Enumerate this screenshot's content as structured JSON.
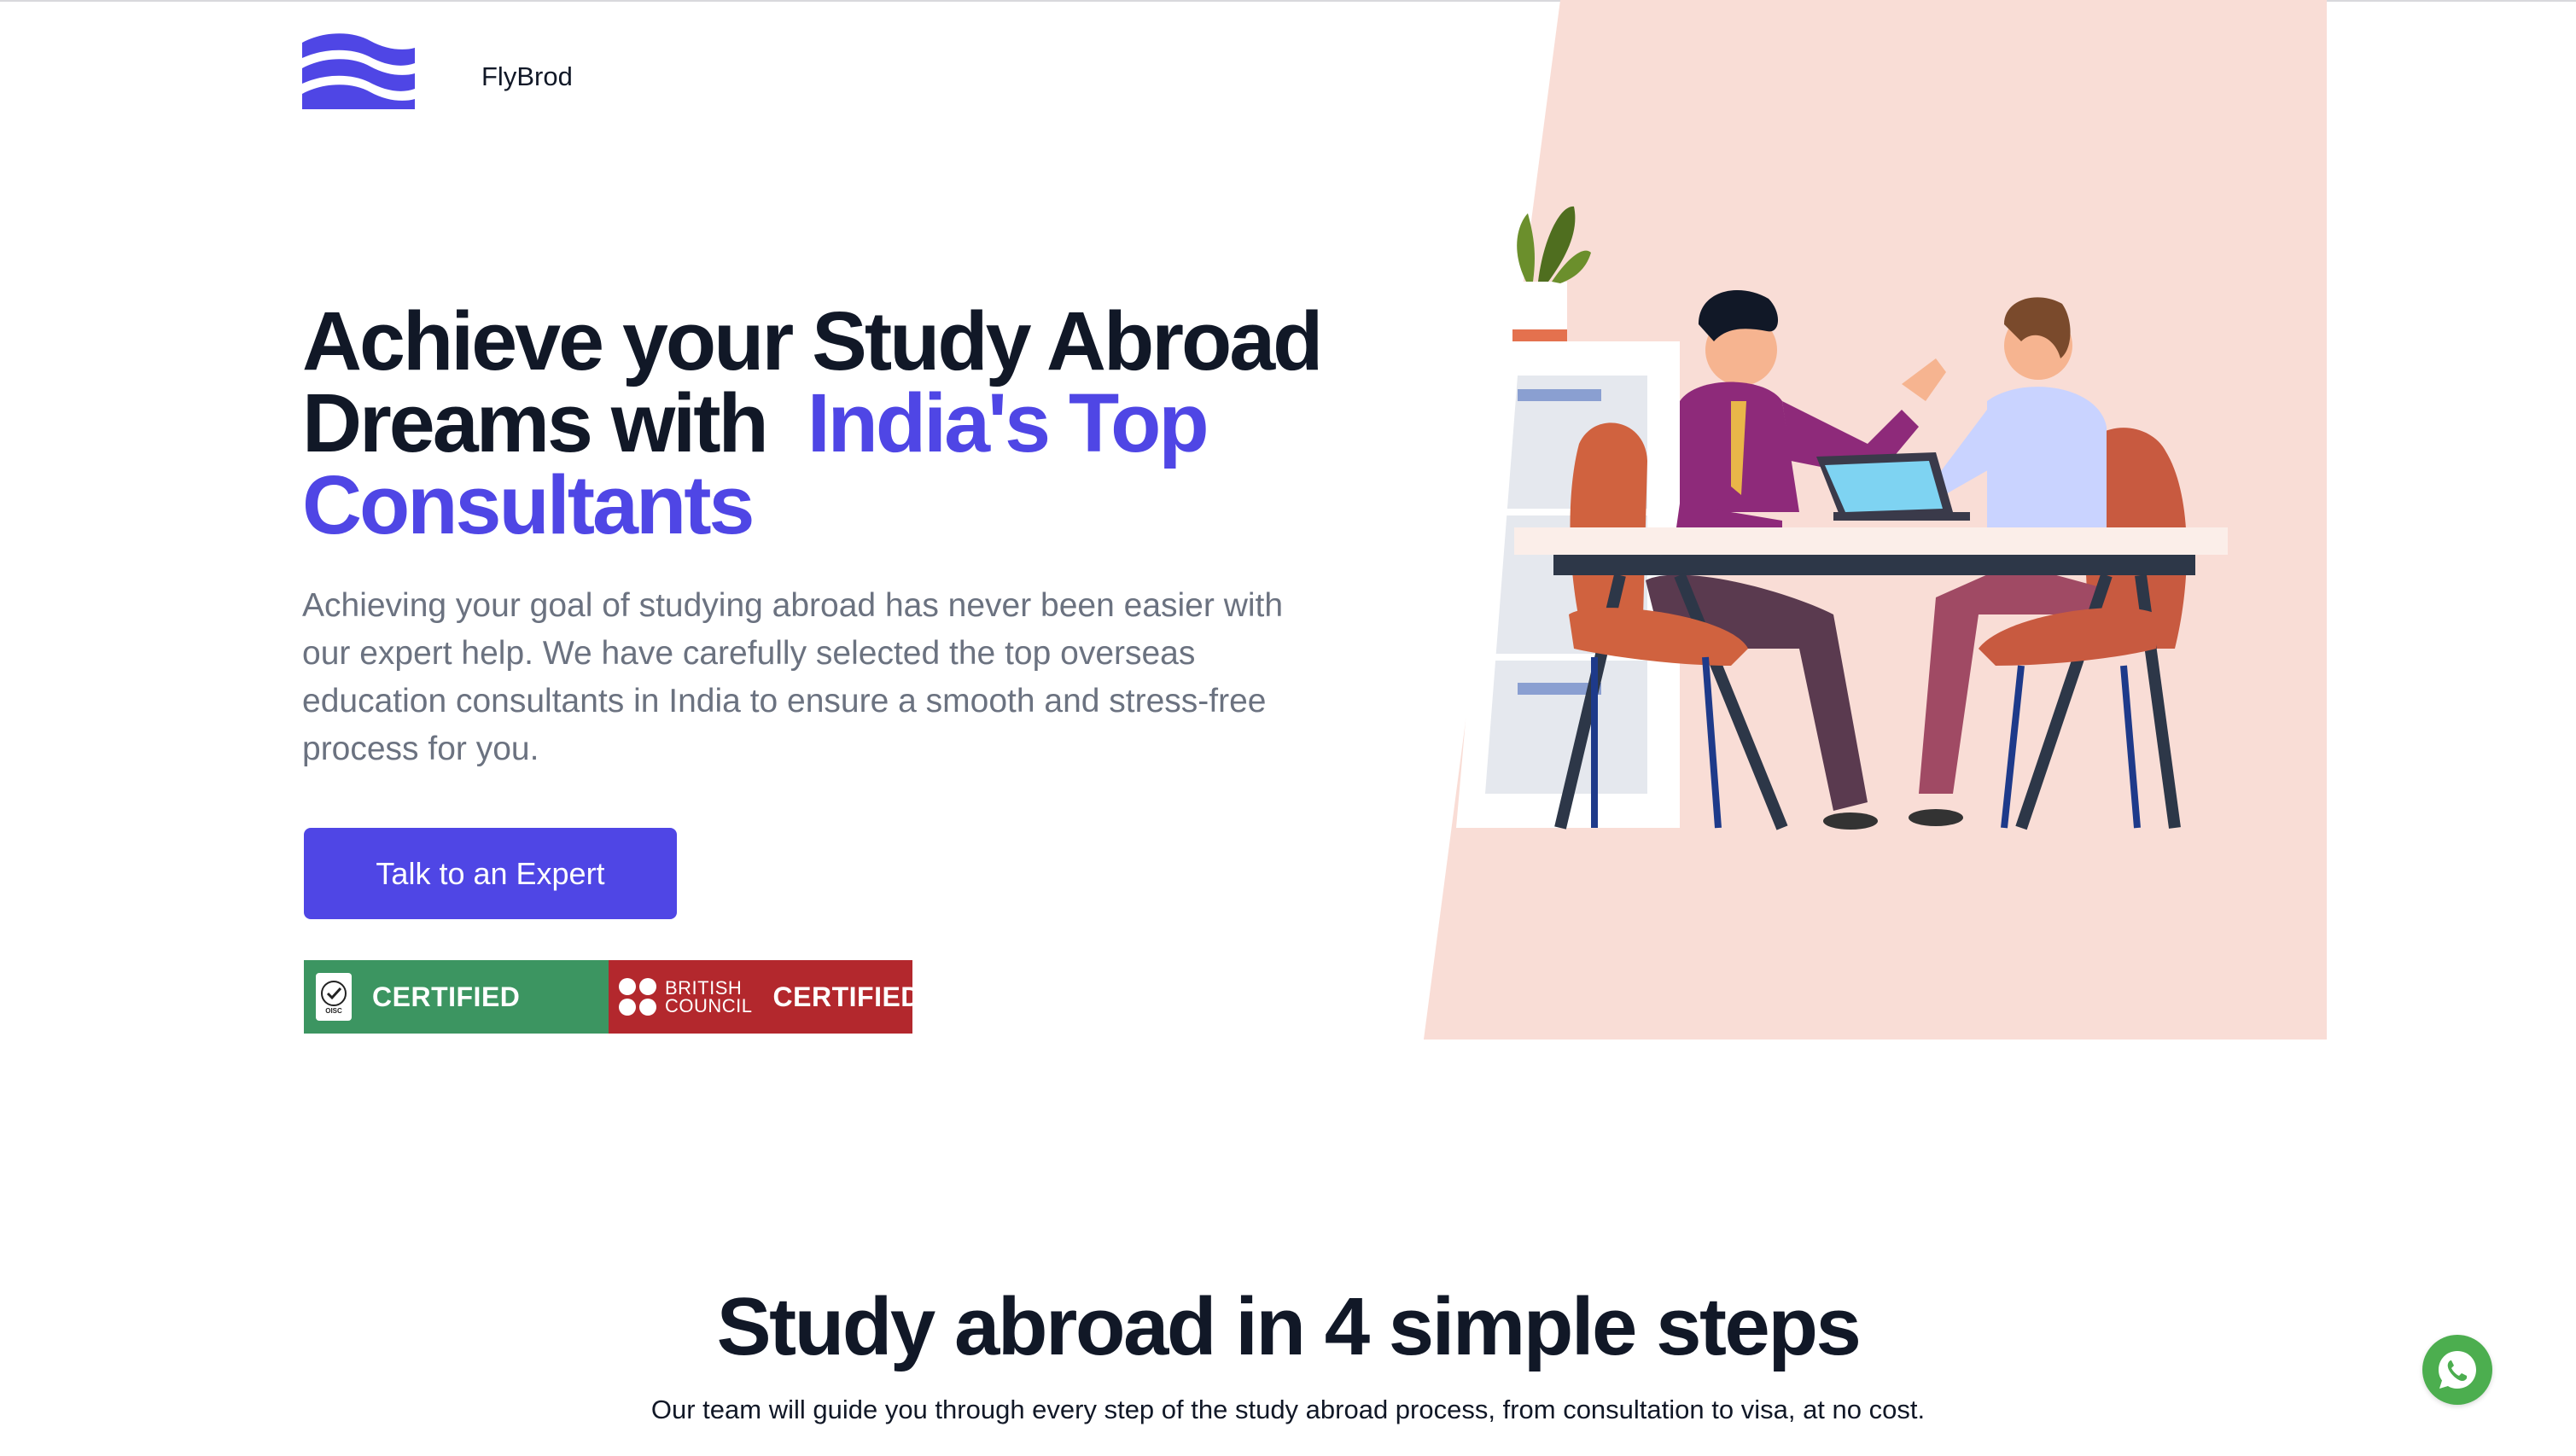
{
  "brand": {
    "name": "FlyBrod",
    "logo_icon": "wave-logo-icon",
    "color": "#4f46e5"
  },
  "hero": {
    "title_line1": "Achieve your Study Abroad",
    "title_line2": "Dreams with",
    "title_accent_line2": "India's Top",
    "title_accent_line3": "Consultants",
    "description": "Achieving your goal of studying abroad has never been easier with our expert help. We have carefully selected the top overseas education consultants in India to ensure a smooth and stress-free process for you.",
    "cta_label": "Talk to an Expert",
    "illustration_icon": "consultation-meeting-illustration"
  },
  "badges": {
    "oisc": {
      "seal_text": "OISC",
      "label": "CERTIFIED",
      "color": "#3c9561"
    },
    "british_council": {
      "line1": "BRITISH",
      "line2": "COUNCIL",
      "label": "CERTIFIED",
      "color": "#b3282d"
    }
  },
  "steps": {
    "title": "Study abroad in 4 simple steps",
    "subtitle": "Our team will guide you through every step of the study abroad process, from consultation to visa, at no cost."
  },
  "whatsapp": {
    "icon": "whatsapp-icon",
    "color": "#4cae4f"
  },
  "colors": {
    "accent": "#4f46e5",
    "hero_panel": "#f9ddd6",
    "body_text": "#6b7280",
    "heading": "#111827"
  }
}
